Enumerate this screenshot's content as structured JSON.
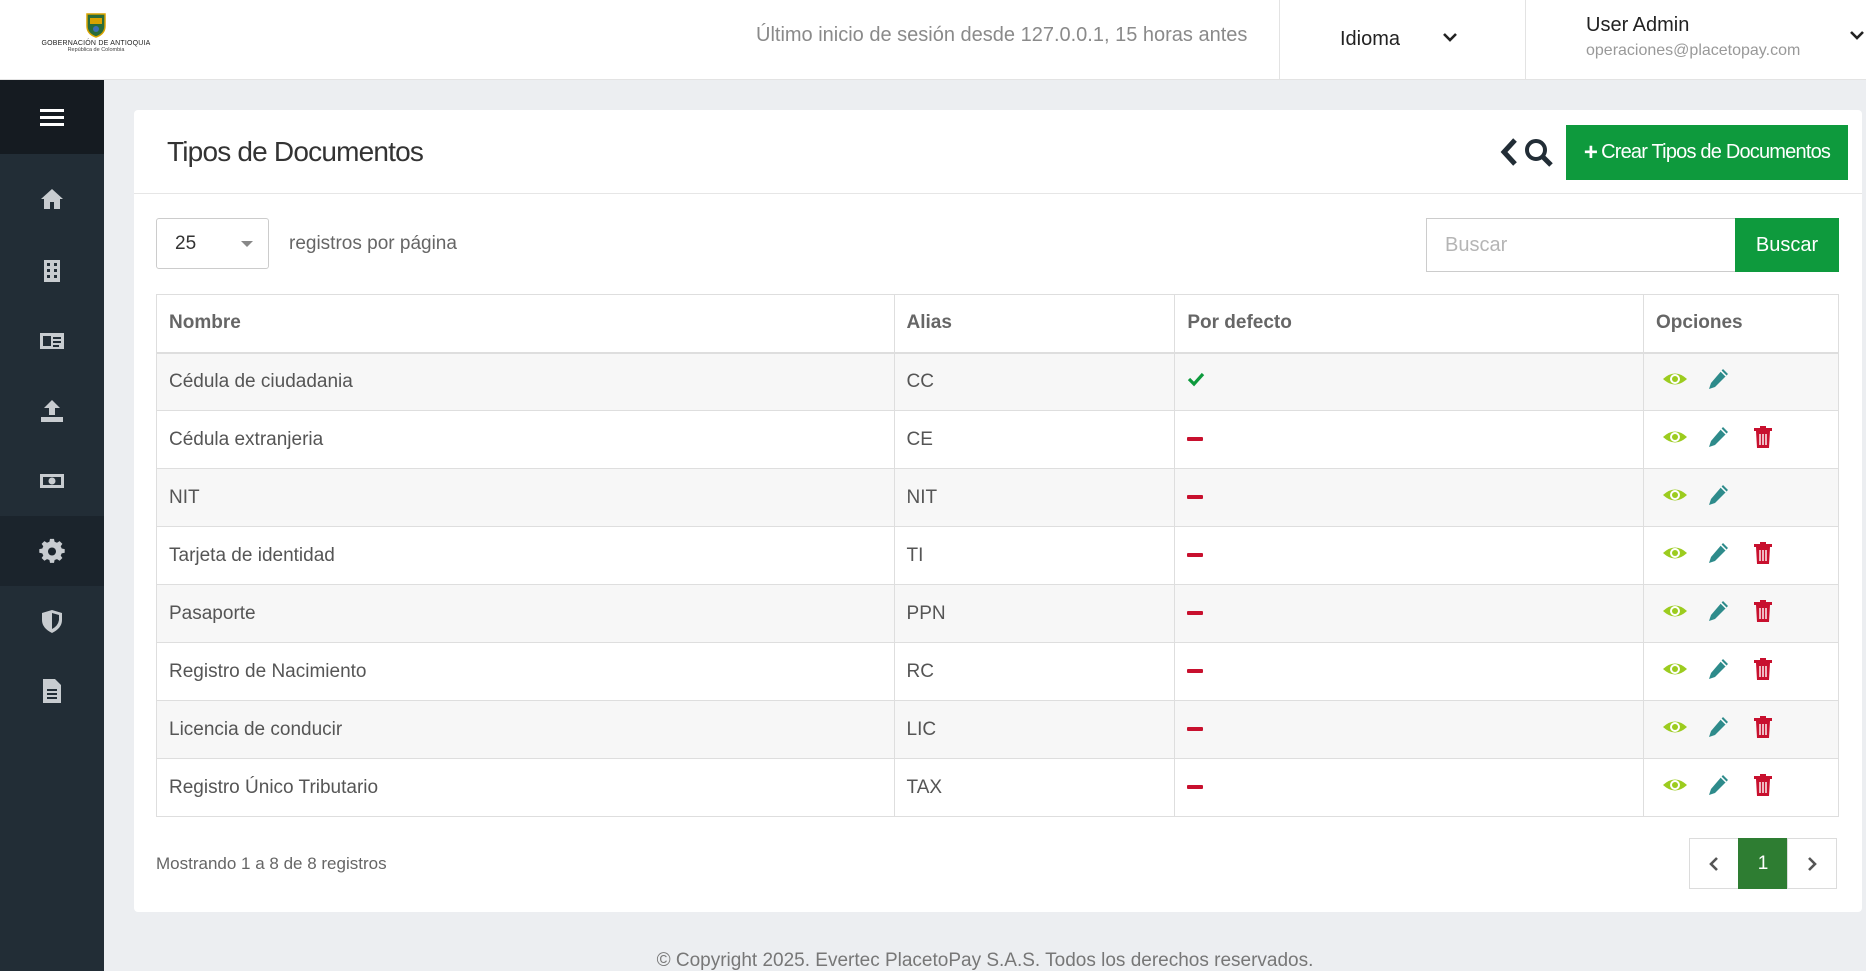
{
  "header": {
    "logo_line1": "GOBERNACIÓN DE ANTIOQUIA",
    "logo_line2": "República de Colombia",
    "last_login": "Último inicio de sesión desde 127.0.0.1, 15 horas antes",
    "language_label": "Idioma",
    "user_name": "User Admin",
    "user_email": "operaciones@placetopay.com"
  },
  "sidebar": {
    "items": [
      {
        "icon": "home-icon"
      },
      {
        "icon": "building-icon"
      },
      {
        "icon": "id-card-icon"
      },
      {
        "icon": "upload-icon"
      },
      {
        "icon": "money-icon"
      },
      {
        "icon": "gear-icon"
      },
      {
        "icon": "shield-icon"
      },
      {
        "icon": "document-icon"
      }
    ]
  },
  "page": {
    "title": "Tipos de Documentos",
    "create_button": "Crear Tipos de Documentos",
    "per_page_value": "25",
    "per_page_label": "registros por página",
    "search_placeholder": "Buscar",
    "search_button": "Buscar",
    "showing": "Mostrando 1 a 8 de 8 registros",
    "current_page": "1"
  },
  "table": {
    "headers": [
      "Nombre",
      "Alias",
      "Por defecto",
      "Opciones"
    ],
    "rows": [
      {
        "name": "Cédula de ciudadania",
        "alias": "CC",
        "default": true,
        "deletable": false
      },
      {
        "name": "Cédula extranjeria",
        "alias": "CE",
        "default": false,
        "deletable": true
      },
      {
        "name": "NIT",
        "alias": "NIT",
        "default": false,
        "deletable": false
      },
      {
        "name": "Tarjeta de identidad",
        "alias": "TI",
        "default": false,
        "deletable": true
      },
      {
        "name": "Pasaporte",
        "alias": "PPN",
        "default": false,
        "deletable": true
      },
      {
        "name": "Registro de Nacimiento",
        "alias": "RC",
        "default": false,
        "deletable": true
      },
      {
        "name": "Licencia de conducir",
        "alias": "LIC",
        "default": false,
        "deletable": true
      },
      {
        "name": "Registro Único Tributario",
        "alias": "TAX",
        "default": false,
        "deletable": true
      }
    ]
  },
  "footer": {
    "copyright": "© Copyright 2025. Evertec PlacetoPay S.A.S. Todos los derechos reservados."
  },
  "colors": {
    "primary_green": "#0e9a3d",
    "view_icon": "#9ccc1f",
    "edit_icon": "#2e8b8b",
    "delete_icon": "#c8102e",
    "sidebar_bg": "#222d36"
  }
}
